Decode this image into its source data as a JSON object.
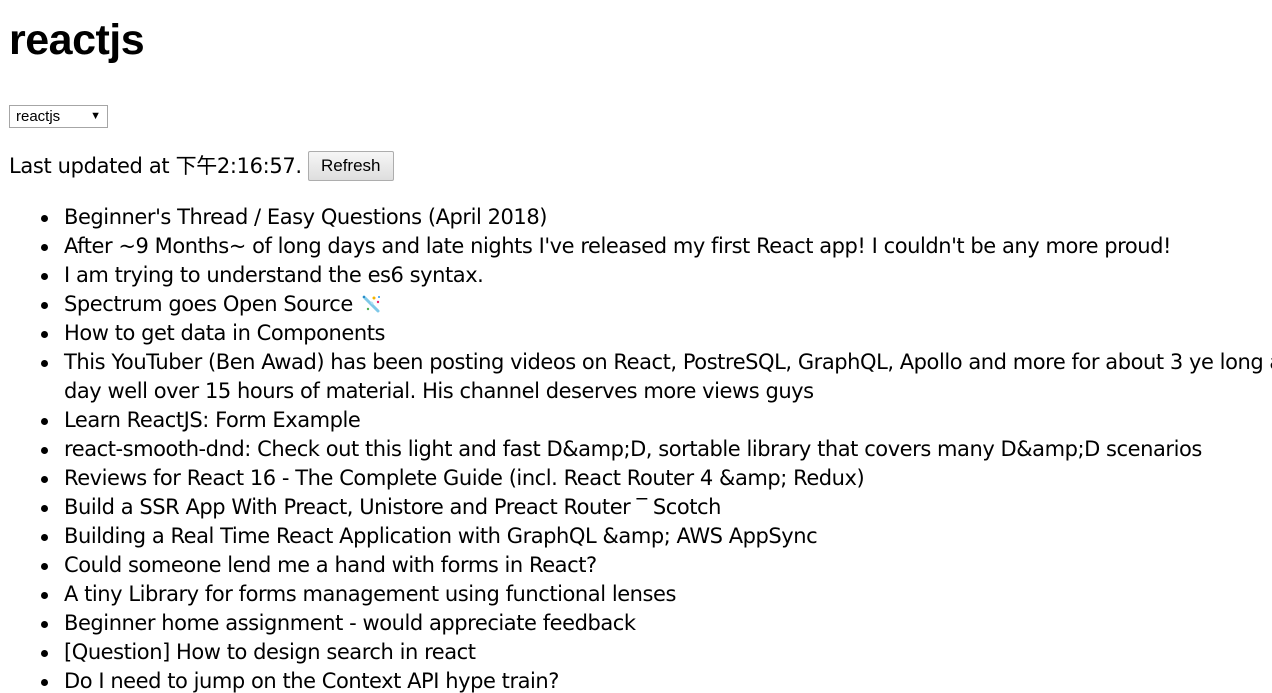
{
  "page": {
    "title": "reactjs"
  },
  "subreddit_select": {
    "selected": "reactjs",
    "arrow_icon": "triangle-down-icon"
  },
  "status": {
    "text": "Last updated at 下午2:16:57.",
    "refresh_label": "Refresh"
  },
  "posts": [
    {
      "title": "Beginner's Thread / Easy Questions (April 2018)"
    },
    {
      "title": "After ~9 Months~ of long days and late nights I've released my first React app! I couldn't be any more proud!"
    },
    {
      "title": "I am trying to understand the es6 syntax."
    },
    {
      "title": "Spectrum goes Open Source",
      "emoji": "sparkle-icon"
    },
    {
      "title": "How to get data in Components"
    },
    {
      "title": "This YouTuber (Ben Awad) has been posting videos on React, PostreSQL, GraphQL, Apollo and more for about 3 ye long a day well over 15 hours of material. His channel deserves more views guys"
    },
    {
      "title": "Learn ReactJS: Form Example"
    },
    {
      "title": "react-smooth-dnd: Check out this light and fast D&amp;D, sortable library that covers many D&amp;D scenarios"
    },
    {
      "title": "Reviews for React 16 - The Complete Guide (incl. React Router 4 &amp; Redux)"
    },
    {
      "title": "Build a SSR App With Preact, Unistore and Preact Router ‾ Scotch"
    },
    {
      "title": "Building a Real Time React Application with GraphQL &amp; AWS AppSync"
    },
    {
      "title": "Could someone lend me a hand with forms in React?"
    },
    {
      "title": "A tiny Library for forms management using functional lenses"
    },
    {
      "title": "Beginner home assignment - would appreciate feedback"
    },
    {
      "title": "[Question] How to design search in react"
    },
    {
      "title": "Do I need to jump on the Context API hype train?"
    }
  ]
}
